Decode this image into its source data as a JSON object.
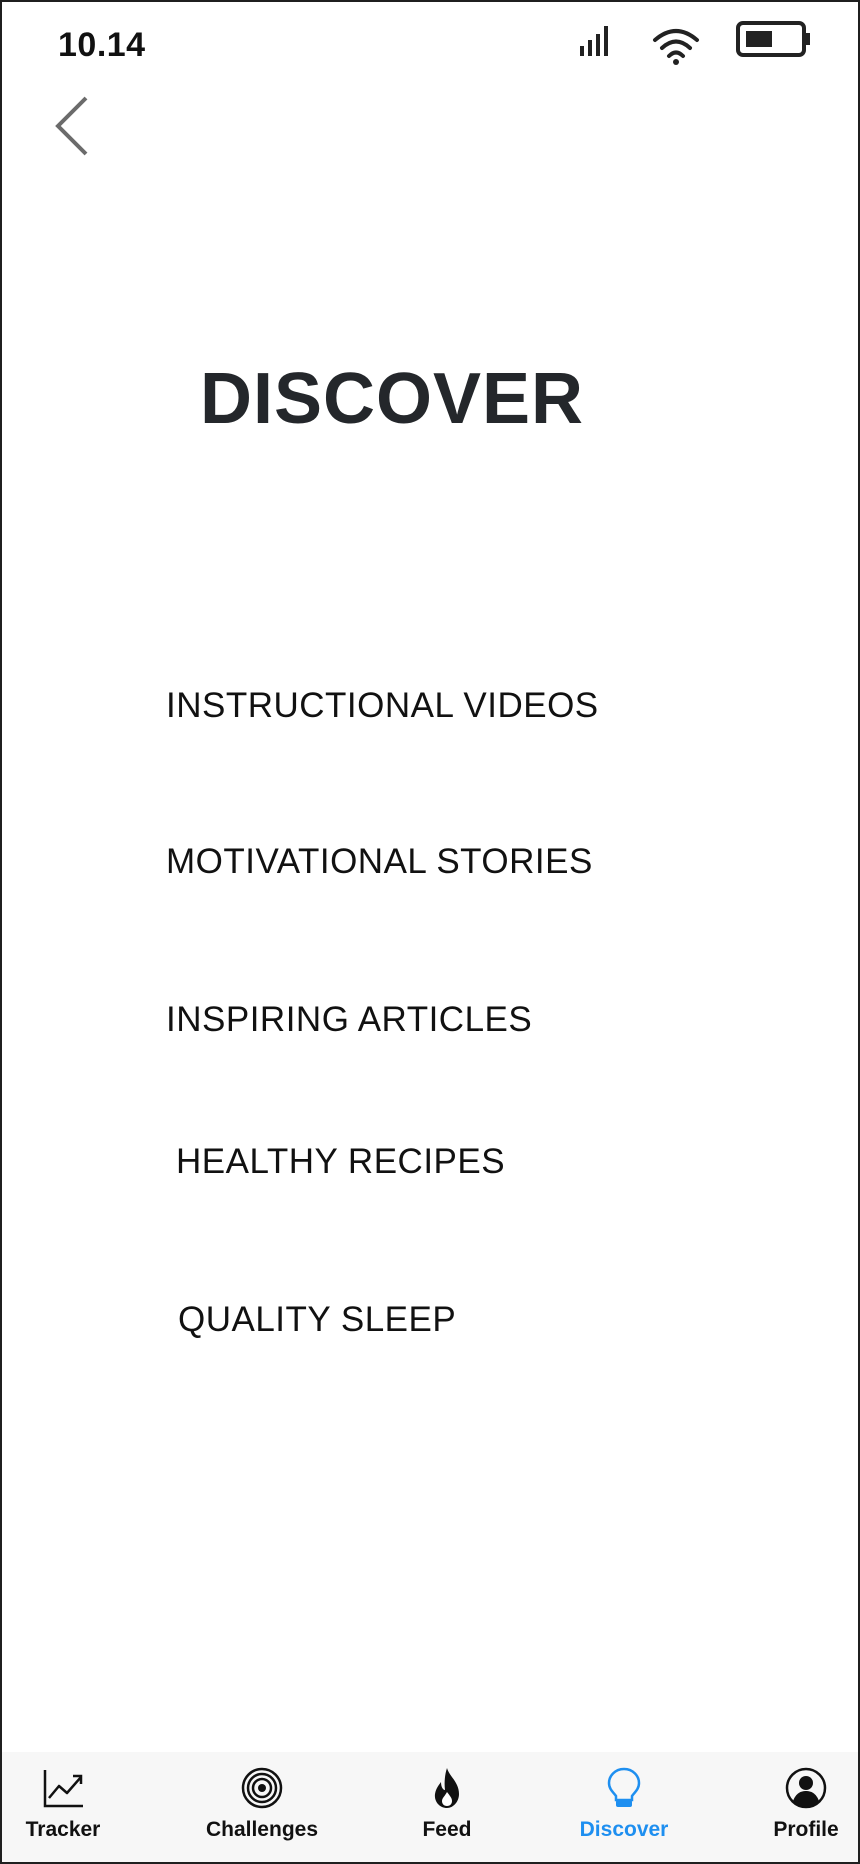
{
  "status_bar": {
    "time": "10.14",
    "icons": [
      "signal-icon",
      "wifi-icon",
      "battery-icon"
    ]
  },
  "header": {
    "back_icon": "chevron-left-icon"
  },
  "page": {
    "title": "DISCOVER"
  },
  "menu": {
    "items": [
      {
        "label": "INSTRUCTIONAL VIDEOS"
      },
      {
        "label": "MOTIVATIONAL STORIES"
      },
      {
        "label": "INSPIRING ARTICLES"
      },
      {
        "label": "HEALTHY RECIPES"
      },
      {
        "label": "QUALITY SLEEP"
      }
    ]
  },
  "bottom_nav": {
    "active": "Discover",
    "accent_color": "#1e8ff0",
    "items": [
      {
        "label": "Tracker",
        "icon": "trend-chart-icon"
      },
      {
        "label": "Challenges",
        "icon": "target-icon"
      },
      {
        "label": "Feed",
        "icon": "flame-icon"
      },
      {
        "label": "Discover",
        "icon": "lightbulb-icon"
      },
      {
        "label": "Profile",
        "icon": "user-circle-icon"
      }
    ]
  }
}
